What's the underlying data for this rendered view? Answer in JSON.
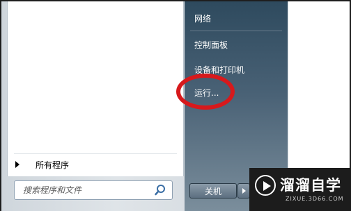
{
  "right_panel": {
    "items": [
      {
        "label": "网络"
      },
      {
        "label": "控制面板"
      },
      {
        "label": "设备和打印机"
      },
      {
        "label": "运行..."
      }
    ]
  },
  "left_panel": {
    "all_programs_label": "所有程序"
  },
  "search": {
    "placeholder": "搜索程序和文件",
    "value": ""
  },
  "shutdown": {
    "label": "关机"
  },
  "watermark": {
    "title": "溜溜自学",
    "url": "ZIXUE.3D66.COM"
  },
  "colors": {
    "annotation_circle": "#d7191c",
    "panel_dark": "#2e4a5e"
  },
  "icons": {
    "search": "search-icon",
    "all_programs_arrow": "triangle-right-icon",
    "shutdown_arrow": "triangle-right-icon",
    "watermark_logo": "play-circle-icon"
  }
}
